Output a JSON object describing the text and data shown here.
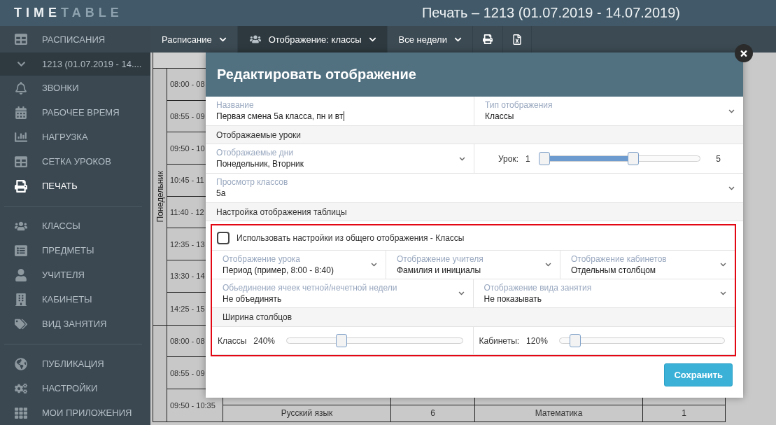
{
  "header": {
    "logo": {
      "bright": "TIME",
      "dim": "TABLE"
    },
    "title": "Печать – 1213 (01.07.2019 - 14.07.2019)"
  },
  "sidebar": {
    "groups": [
      {
        "items": [
          {
            "label": "РАСПИСАНИЯ",
            "kind": "item",
            "selected": false
          },
          {
            "label": "1213 (01.07.2019 - 14....",
            "kind": "subitem",
            "expanded": true,
            "selected": false
          },
          {
            "label": "ЗВОНКИ",
            "kind": "item",
            "selected": false
          },
          {
            "label": "РАБОЧЕЕ ВРЕМЯ",
            "kind": "item",
            "selected": false
          },
          {
            "label": "НАГРУЗКА",
            "kind": "item",
            "selected": false
          },
          {
            "label": "СЕТКА УРОКОВ",
            "kind": "item",
            "selected": false
          },
          {
            "label": "ПЕЧАТЬ",
            "kind": "item",
            "selected": true
          }
        ]
      },
      {
        "items": [
          {
            "label": "КЛАССЫ",
            "kind": "item",
            "selected": false
          },
          {
            "label": "ПРЕДМЕТЫ",
            "kind": "item",
            "selected": false
          },
          {
            "label": "УЧИТЕЛЯ",
            "kind": "item",
            "selected": false
          },
          {
            "label": "КАБИНЕТЫ",
            "kind": "item",
            "selected": false
          },
          {
            "label": "ВИД ЗАНЯТИЯ",
            "kind": "item",
            "selected": false
          }
        ]
      },
      {
        "items": [
          {
            "label": "ПУБЛИКАЦИЯ",
            "kind": "item",
            "selected": false
          },
          {
            "label": "НАСТРОЙКИ",
            "kind": "item",
            "selected": false
          },
          {
            "label": "МОИ ПРИЛОЖЕНИЯ",
            "kind": "item",
            "selected": false
          }
        ]
      }
    ]
  },
  "toolbar": {
    "items": [
      {
        "kind": "dropdown",
        "label": "Расписание",
        "selected": false
      },
      {
        "kind": "icon-dropdown",
        "label": "Отображение: классы",
        "selected": true
      },
      {
        "kind": "dropdown",
        "label": "Все недели",
        "selected": false
      },
      {
        "kind": "print",
        "selected": false
      },
      {
        "kind": "excel",
        "selected": false
      }
    ]
  },
  "schedule": {
    "days": [
      {
        "label": "Понедельник",
        "slots": [
          {
            "time": "08:00 - 08"
          },
          {
            "time": "08:55 - 09"
          },
          {
            "time": "09:50 - 10"
          },
          {
            "time": "10:45 - 11"
          },
          {
            "time": "11:40 - 12"
          },
          {
            "time": "12:35 - 13"
          },
          {
            "time": "13:30 - 14"
          },
          {
            "time": "14:25 - 15"
          }
        ]
      },
      {
        "slots": [
          {
            "time": "08:00 - 08"
          },
          {
            "time": "08:55 - 09"
          },
          {
            "time": "09:50 - 10:35",
            "lessons": [
              "Русский язык",
              "6",
              "Математика",
              "1"
            ]
          }
        ]
      }
    ]
  },
  "modal": {
    "title": "Редактировать отображение",
    "rows": [
      {
        "kind": "fields",
        "fields": [
          {
            "kind": "text",
            "label": "Название",
            "value": "Первая смена 5а класса, пн и вт",
            "focused": true
          },
          {
            "kind": "select",
            "label": "Тип отображения",
            "value": "Классы"
          }
        ]
      },
      {
        "kind": "section",
        "label": "Отображаемые уроки"
      },
      {
        "kind": "fields",
        "fields": [
          {
            "kind": "select",
            "label": "Отображаемые дни",
            "value": "Понедельник, Вторник"
          },
          {
            "kind": "range",
            "label": "Урок:",
            "min": "1",
            "max": "5",
            "start": {
              "level": 0
            },
            "end": {
              "level": 0.59
            }
          }
        ]
      },
      {
        "kind": "fields",
        "fields": [
          {
            "kind": "select",
            "label": "Просмотр классов",
            "value": "5а"
          }
        ]
      },
      {
        "kind": "section",
        "label": "Настройка отображения таблицы"
      },
      {
        "kind": "group",
        "highlighted": true,
        "rows": [
          {
            "kind": "checkbox",
            "label": "Использовать настройки из общего отображения - Классы",
            "checked": false
          },
          {
            "kind": "fields",
            "fields": [
              {
                "kind": "select",
                "label": "Отображение урока",
                "value": "Период (пример, 8:00 - 8:40)"
              },
              {
                "kind": "select",
                "label": "Отображение учителя",
                "value": "Фамилия и инициалы"
              },
              {
                "kind": "select",
                "label": "Отображение кабинетов",
                "value": "Отдельным столбцом"
              }
            ]
          },
          {
            "kind": "fields",
            "fields": [
              {
                "kind": "select",
                "label": "Обьединение ячеек четной/нечетной недели",
                "value": "Не объединять"
              },
              {
                "kind": "select",
                "label": "Отображение вида занятия",
                "value": "Не показывать"
              }
            ]
          },
          {
            "kind": "section",
            "label": "Ширина столбцов"
          },
          {
            "kind": "fields",
            "fields": [
              {
                "kind": "slider",
                "label": "Классы",
                "reading": "240%",
                "level": 0.3
              },
              {
                "kind": "slider",
                "label": "Кабинеты:",
                "reading": "120%",
                "level": 0.07
              }
            ]
          }
        ]
      }
    ],
    "save_button": "Сохранить"
  }
}
